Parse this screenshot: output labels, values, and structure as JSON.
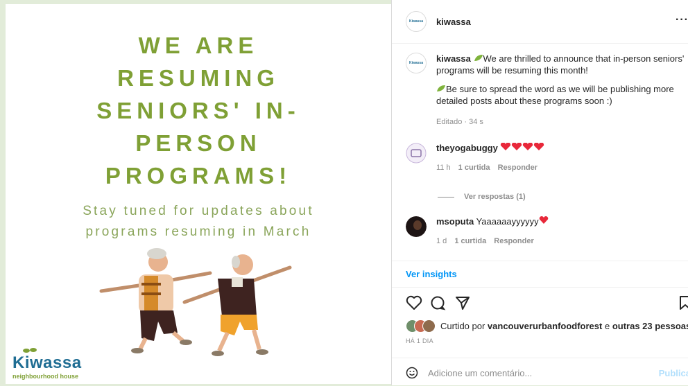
{
  "image": {
    "headline": [
      "WE ARE",
      "RESUMING",
      "SENIORS' IN-",
      "PERSON",
      "PROGRAMS!"
    ],
    "subline": [
      "Stay tuned for updates about",
      "programs resuming in March"
    ],
    "logo_word": "Kiwassa",
    "logo_sub": "neighbourhood house"
  },
  "header": {
    "username": "kiwassa",
    "more": "···",
    "avatar_text": "Kiwassa"
  },
  "caption": {
    "username": "kiwassa",
    "text1": "We are thrilled to announce that in-person seniors' programs will be resuming this month!",
    "text2": "Be sure to spread the word as we will be publishing more detailed posts about these programs soon :)",
    "meta": "Editado · 34 s"
  },
  "comments": [
    {
      "username": "theyogabuggy",
      "text": "",
      "time": "11 h",
      "likes": "1 curtida",
      "reply": "Responder"
    },
    {
      "username": "msoputa",
      "text": "Yaaaaaayyyyyy",
      "time": "1 d",
      "likes": "1 curtida",
      "reply": "Responder"
    }
  ],
  "view_replies": "Ver respostas (1)",
  "insights": "Ver insights",
  "liked": {
    "prefix": "Curtido por ",
    "user": "vancouverurbanfoodforest",
    "mid": " e ",
    "others": "outras 23 pessoas"
  },
  "time_ago": "HÁ 1 DIA",
  "add_comment": {
    "placeholder": "Adicione um comentário...",
    "publish": "Publicar"
  },
  "colors": {
    "accent_green": "#7fa035",
    "link_blue": "#0095f6",
    "heart_red": "#ed4956"
  }
}
